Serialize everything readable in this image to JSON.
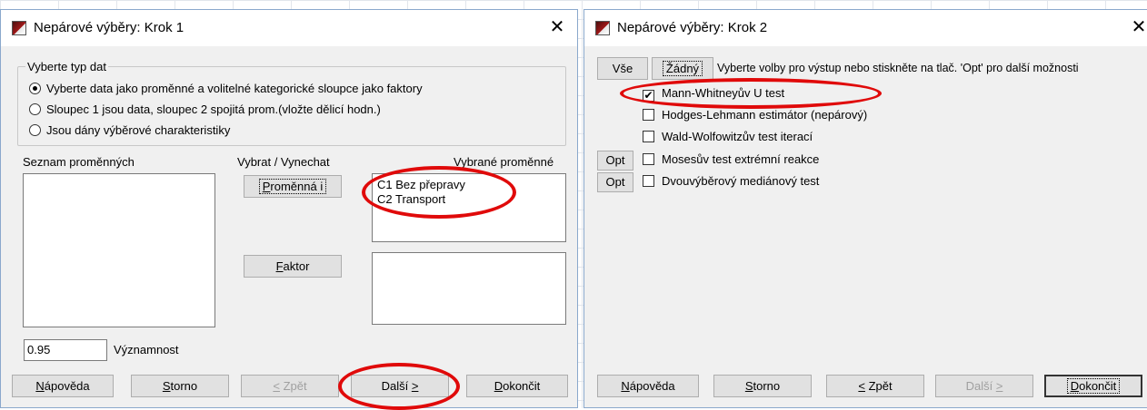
{
  "step1": {
    "title": "Nepárové výběry: Krok 1",
    "close_glyph": "✕",
    "data_type_group": {
      "legend": "Vyberte typ dat",
      "options": [
        {
          "label": "Vyberte data jako proměnné a volitelné kategorické sloupce jako faktory",
          "selected": true
        },
        {
          "label": "Sloupec 1 jsou data, sloupec 2 spojitá prom.(vložte dělicí hodn.)",
          "selected": false
        },
        {
          "label": "Jsou dány výběrové charakteristiky",
          "selected": false
        }
      ]
    },
    "variable_list_label": "Seznam proměnných",
    "select_label": "Vybrat / Vynechat",
    "selected_label": "Vybrané proměnné",
    "variable_button": {
      "pre": "",
      "hot": "P",
      "post": "roměnná i"
    },
    "factor_button": {
      "pre": "",
      "hot": "F",
      "post": "aktor"
    },
    "selected_variables": [
      "C1 Bez přepravy",
      "C2 Transport"
    ],
    "significance_value": "0.95",
    "significance_label": "Významnost",
    "buttons": {
      "help": {
        "pre": "",
        "hot": "N",
        "post": "ápověda"
      },
      "cancel": {
        "pre": "",
        "hot": "S",
        "post": "torno"
      },
      "back": {
        "pre": "",
        "hot": "<",
        "post": " Zpět"
      },
      "next": {
        "pre": "Další ",
        "hot": ">",
        "post": ""
      },
      "finish": {
        "pre": "",
        "hot": "D",
        "post": "okončit"
      }
    }
  },
  "step2": {
    "title": "Nepárové výběry: Krok 2",
    "close_glyph": "✕",
    "all_button": "Vše",
    "none_button": "Žádný",
    "instruction": "Vyberte volby pro výstup nebo stiskněte na tlač. 'Opt' pro další možnosti",
    "opt_label": "Opt",
    "tests": [
      {
        "label": "Mann-Whitneyův U test",
        "checked": true,
        "has_opt": false
      },
      {
        "label": "Hodges-Lehmann estimátor (nepárový)",
        "checked": false,
        "has_opt": false
      },
      {
        "label": "Wald-Wolfowitzův test iterací",
        "checked": false,
        "has_opt": false
      },
      {
        "label": "Mosesův test extrémní reakce",
        "checked": false,
        "has_opt": true
      },
      {
        "label": "Dvouvýběrový mediánový test",
        "checked": false,
        "has_opt": true
      }
    ],
    "check_glyph": "✔",
    "buttons": {
      "help": {
        "pre": "",
        "hot": "N",
        "post": "ápověda"
      },
      "cancel": {
        "pre": "",
        "hot": "S",
        "post": "torno"
      },
      "back": {
        "pre": "",
        "hot": "<",
        "post": " Zpět"
      },
      "next": {
        "pre": "Další ",
        "hot": ">",
        "post": ""
      },
      "finish": {
        "pre": "",
        "hot": "D",
        "post": "okončit"
      }
    }
  },
  "colors": {
    "annotation": "#e00a0a",
    "dialog_bg": "#f0f0f0",
    "titlebar_bg": "#ffffff",
    "button_bg": "#e1e1e1"
  }
}
